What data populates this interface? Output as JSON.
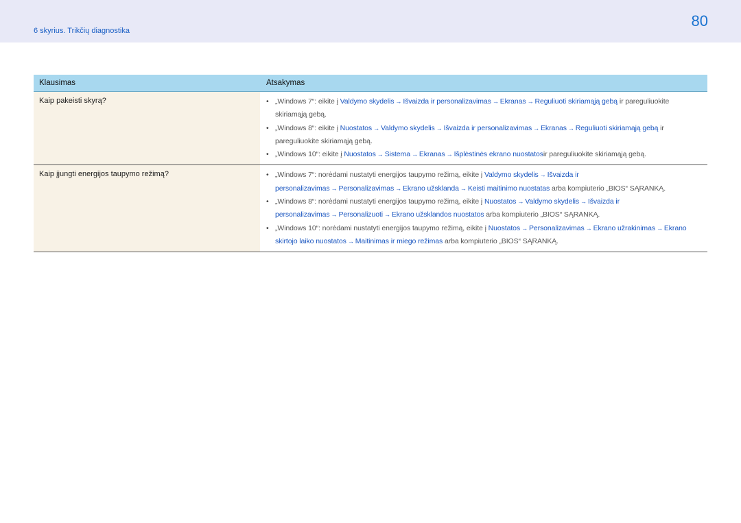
{
  "header": {
    "chapter": "6 skyrius. Trikčių diagnostika",
    "page_number": "80"
  },
  "table": {
    "col_question": "Klausimas",
    "col_answer": "Atsakymas",
    "rows": [
      {
        "question": "Kaip pakeisti skyrą?",
        "answers": [
          [
            {
              "t": "„Windows 7“: eikite į ",
              "link": false
            },
            {
              "t": "Valdymo skydelis",
              "link": true
            },
            {
              "t": "→",
              "arrow": true
            },
            {
              "t": "Išvaizda ir personalizavimas",
              "link": true
            },
            {
              "t": "→",
              "arrow": true
            },
            {
              "t": "Ekranas",
              "link": true
            },
            {
              "t": "→",
              "arrow": true
            },
            {
              "t": "Reguliuoti skiriamąją gebą",
              "link": true
            },
            {
              "t": " ir pareguliuokite skiriamąją gebą.",
              "link": false
            }
          ],
          [
            {
              "t": "„Windows 8“: eikite į ",
              "link": false
            },
            {
              "t": "Nuostatos",
              "link": true
            },
            {
              "t": "→",
              "arrow": true
            },
            {
              "t": "Valdymo skydelis",
              "link": true
            },
            {
              "t": "→",
              "arrow": true
            },
            {
              "t": "Išvaizda ir personalizavimas",
              "link": true
            },
            {
              "t": "→",
              "arrow": true
            },
            {
              "t": "Ekranas",
              "link": true
            },
            {
              "t": "→",
              "arrow": true
            },
            {
              "t": "Reguliuoti skiriamąją gebą",
              "link": true
            },
            {
              "t": " ir pareguliuokite skiriamąją gebą.",
              "link": false
            }
          ],
          [
            {
              "t": "„Windows 10“: eikite į ",
              "link": false
            },
            {
              "t": "Nuostatos",
              "link": true
            },
            {
              "t": "→",
              "arrow": true
            },
            {
              "t": "Sistema",
              "link": true
            },
            {
              "t": "→",
              "arrow": true
            },
            {
              "t": "Ekranas",
              "link": true
            },
            {
              "t": "→",
              "arrow": true
            },
            {
              "t": "Išplėstinės ekrano nuostatos",
              "link": true
            },
            {
              "t": "ir pareguliuokite skiriamąją gebą.",
              "link": false
            }
          ]
        ]
      },
      {
        "question": "Kaip įjungti energijos taupymo režimą?",
        "answers": [
          [
            {
              "t": "„Windows 7“: norėdami nustatyti energijos taupymo režimą, eikite į ",
              "link": false
            },
            {
              "t": "Valdymo skydelis",
              "link": true
            },
            {
              "t": "→",
              "arrow": true
            },
            {
              "t": "Išvaizda ir personalizavimas",
              "link": true
            },
            {
              "t": "→",
              "arrow": true
            },
            {
              "t": "Personalizavimas",
              "link": true
            },
            {
              "t": "→",
              "arrow": true
            },
            {
              "t": "Ekrano užsklanda",
              "link": true
            },
            {
              "t": "→",
              "arrow": true
            },
            {
              "t": "Keisti maitinimo nuostatas",
              "link": true
            },
            {
              "t": " arba kompiuterio „BIOS“ SĄRANKĄ.",
              "link": false
            }
          ],
          [
            {
              "t": "„Windows 8“: norėdami nustatyti energijos taupymo režimą, eikite į ",
              "link": false
            },
            {
              "t": "Nuostatos",
              "link": true
            },
            {
              "t": "→",
              "arrow": true
            },
            {
              "t": "Valdymo skydelis",
              "link": true
            },
            {
              "t": "→",
              "arrow": true
            },
            {
              "t": "Išvaizda ir personalizavimas",
              "link": true
            },
            {
              "t": "→",
              "arrow": true
            },
            {
              "t": "Personalizuoti",
              "link": true
            },
            {
              "t": "→",
              "arrow": true
            },
            {
              "t": "Ekrano užsklandos nuostatos",
              "link": true
            },
            {
              "t": " arba kompiuterio „BIOS“ SĄRANKĄ.",
              "link": false
            }
          ],
          [
            {
              "t": "„Windows 10“: norėdami nustatyti energijos taupymo režimą, eikite į ",
              "link": false
            },
            {
              "t": "Nuostatos",
              "link": true
            },
            {
              "t": "→",
              "arrow": true
            },
            {
              "t": "Personalizavimas",
              "link": true
            },
            {
              "t": "→",
              "arrow": true
            },
            {
              "t": "Ekrano užrakinimas",
              "link": true
            },
            {
              "t": "→",
              "arrow": true
            },
            {
              "t": "Ekrano skirtojo laiko nuostatos",
              "link": true
            },
            {
              "t": "→",
              "arrow": true
            },
            {
              "t": "Maitinimas ir miego režimas",
              "link": true
            },
            {
              "t": " arba kompiuterio „BIOS“ SĄRANKĄ.",
              "link": false
            }
          ]
        ]
      }
    ]
  }
}
